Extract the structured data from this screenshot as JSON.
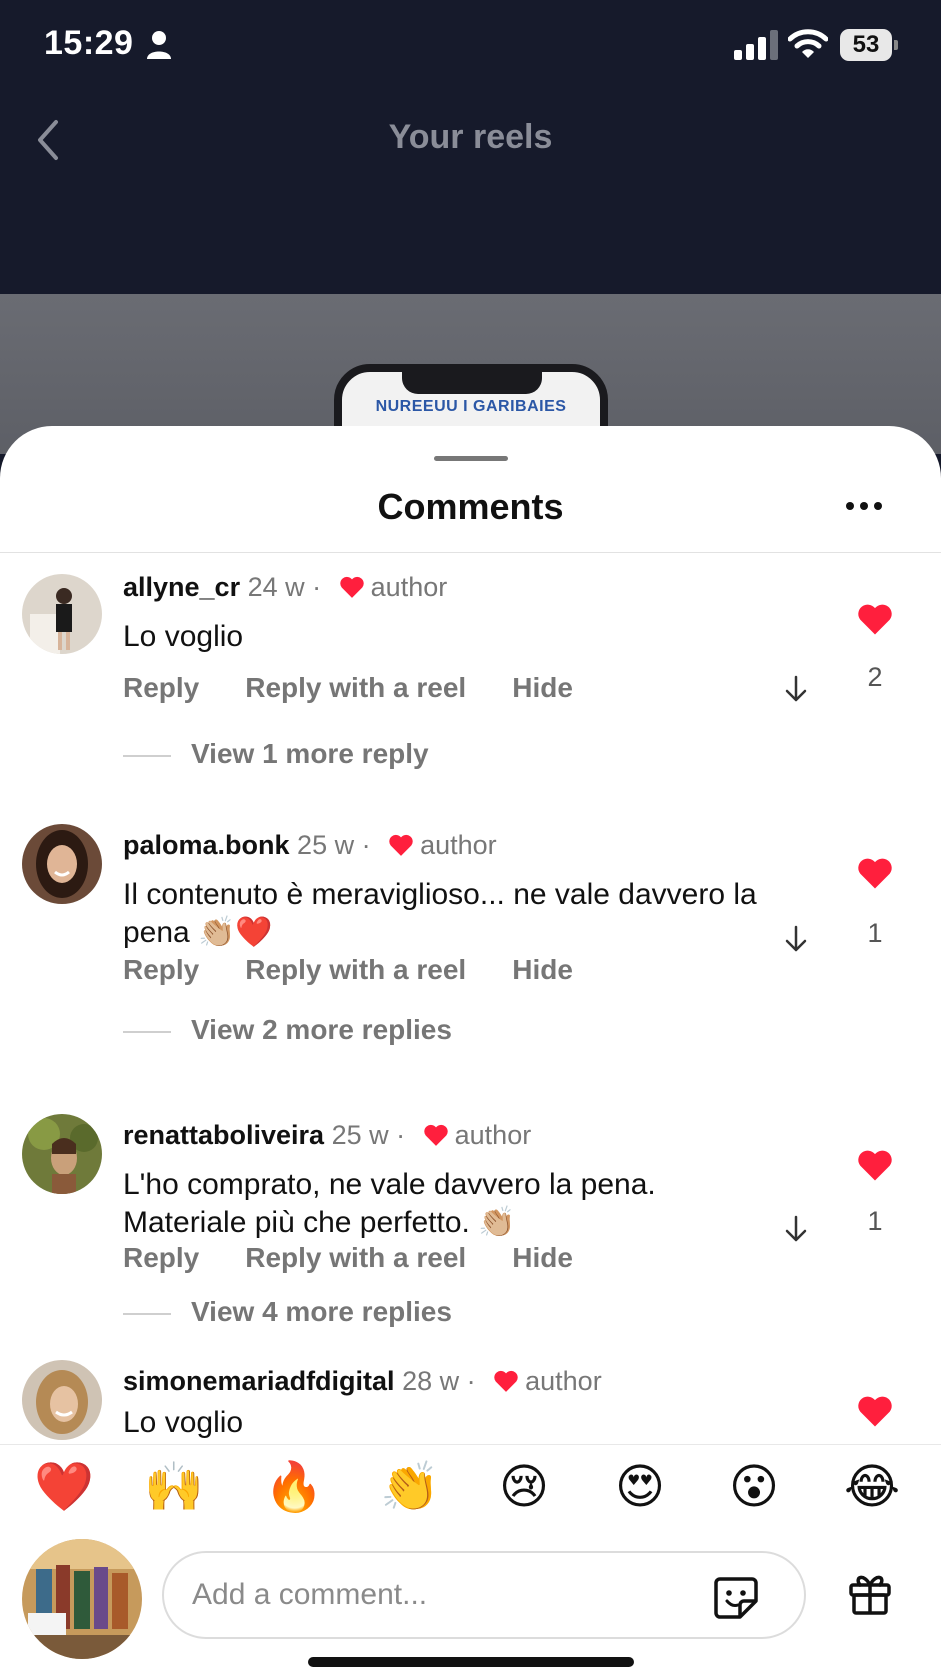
{
  "status_bar": {
    "time": "15:29",
    "battery": "53"
  },
  "header": {
    "title": "Your reels"
  },
  "reel_preview": {
    "phone_text": "NUREEUU I GARIBAIES"
  },
  "sheet": {
    "title": "Comments",
    "author_label": "author",
    "actions": {
      "reply": "Reply",
      "reply_with_reel": "Reply with a reel",
      "hide": "Hide"
    }
  },
  "comments": [
    {
      "username": "allyne_cr",
      "age": "24 w",
      "text": "Lo voglio",
      "likes": "2",
      "view_replies": "View 1 more reply"
    },
    {
      "username": "paloma.bonk",
      "age": "25 w",
      "text": "Il contenuto è meraviglioso... ne vale davvero la pena 👏🏼❤️",
      "likes": "1",
      "view_replies": "View 2 more replies"
    },
    {
      "username": "renattaboliveira",
      "age": "25 w",
      "text": "L'ho comprato, ne vale davvero la pena. Materiale più che perfetto. 👏🏼",
      "likes": "1",
      "view_replies": "View 4 more replies"
    },
    {
      "username": "simonemariadfdigital",
      "age": "28 w",
      "text": "Lo voglio",
      "likes": "",
      "view_replies": ""
    }
  ],
  "emoji_bar": [
    "❤️",
    "🙌",
    "🔥",
    "👏",
    "😢",
    "😍",
    "😮",
    "😂"
  ],
  "composer": {
    "placeholder": "Add a comment..."
  },
  "colors": {
    "header_bg": "#161a2b",
    "like_red": "#ff1f3d",
    "muted_text": "#767676"
  }
}
